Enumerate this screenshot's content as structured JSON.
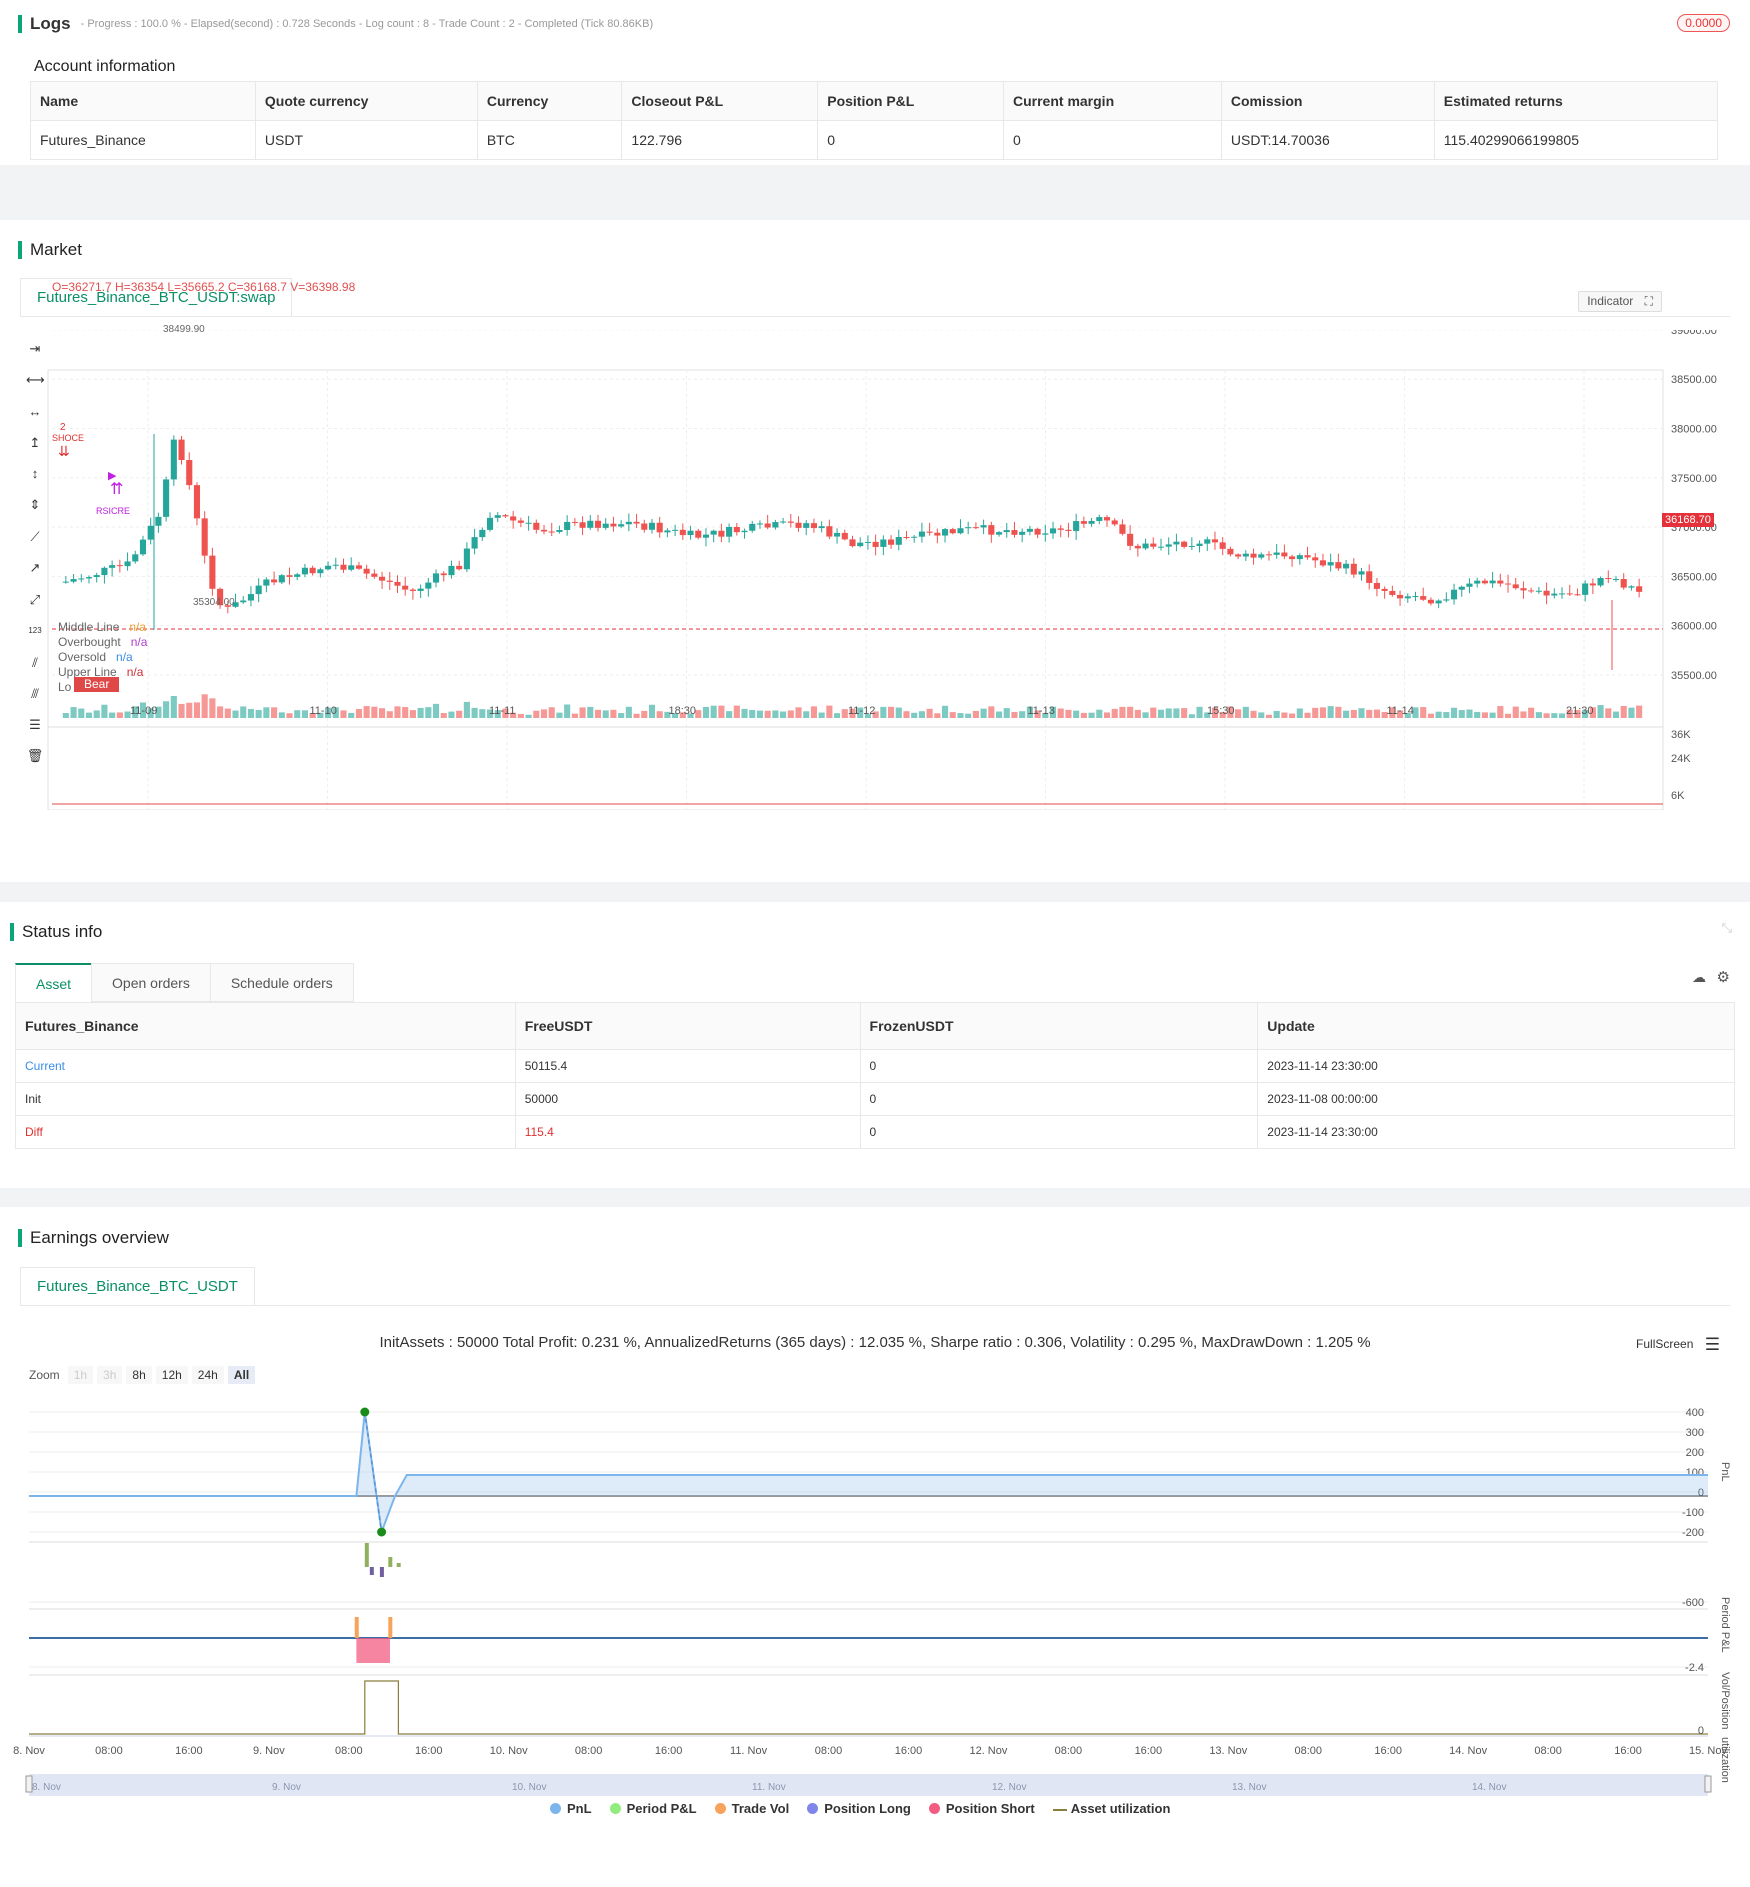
{
  "logs": {
    "title": "Logs",
    "status": "- Progress : 100.0 % - Elapsed(second) : 0.728 Seconds - Log count : 8 - Trade Count : 2 - Completed (Tick 80.86KB)",
    "badge": "0.0000"
  },
  "account": {
    "title": "Account information",
    "headers": [
      "Name",
      "Quote currency",
      "Currency",
      "Closeout P&L",
      "Position P&L",
      "Current margin",
      "Comission",
      "Estimated returns"
    ],
    "row": [
      "Futures_Binance",
      "USDT",
      "BTC",
      "122.796",
      "0",
      "0",
      "USDT:14.70036",
      "115.40299066199805"
    ]
  },
  "market": {
    "title": "Market",
    "tab": "Futures_Binance_BTC_USDT:swap",
    "ohlc": "O=36271.7 H=36354 L=35665.2 C=36168.7 V=36398.98",
    "indicator_btn": "Indicator",
    "price_axis": [
      "39000.00",
      "38500.00",
      "38000.00",
      "37500.00",
      "37000.00",
      "36500.00",
      "36000.00",
      "35500.00"
    ],
    "current_price": "36168.70",
    "high_label": "38499.90",
    "low_label": "35304.00",
    "vol_axis": [
      "36K",
      "24K",
      "6K"
    ],
    "time_axis": [
      "11-09",
      "11-10",
      "11-11",
      "18:30",
      "11-12",
      "11-13",
      "15:30",
      "11-14",
      "21:30"
    ],
    "legend": [
      {
        "name": "Middle Line",
        "value": "n/a",
        "color": "#f0a030"
      },
      {
        "name": "Overbought",
        "value": "n/a",
        "color": "#b040d0"
      },
      {
        "name": "Oversold",
        "value": "n/a",
        "color": "#3a8ee6"
      },
      {
        "name": "Upper Line",
        "value": "n/a",
        "color": "#d0303a"
      },
      {
        "name": "Lo",
        "value": "n/a",
        "color": "#26a69a"
      }
    ],
    "bear_label": "Bear",
    "sig_top": "2",
    "sig_close": "SHOCE",
    "sig_rsi": "RSICRE",
    "colors": {
      "up": "#26a69a",
      "down": "#ef5350"
    }
  },
  "status": {
    "title": "Status info",
    "tabs": [
      "Asset",
      "Open orders",
      "Schedule orders"
    ],
    "headers": [
      "Futures_Binance",
      "FreeUSDT",
      "FrozenUSDT",
      "Update"
    ],
    "rows": [
      [
        "Current",
        "50115.4",
        "0",
        "2023-11-14 23:30:00"
      ],
      [
        "Init",
        "50000",
        "0",
        "2023-11-08 00:00:00"
      ],
      [
        "Diff",
        "115.4",
        "0",
        "2023-11-14 23:30:00"
      ]
    ]
  },
  "earnings": {
    "title": "Earnings overview",
    "tab": "Futures_Binance_BTC_USDT",
    "summary": "InitAssets : 50000 Total Profit: 0.231 %, AnnualizedReturns (365 days) : 12.035 %, Sharpe ratio : 0.306, Volatility : 0.295 %, MaxDrawDown : 1.205 %",
    "fullscreen": "FullScreen",
    "zoom_label": "Zoom",
    "zoom": [
      "1h",
      "3h",
      "8h",
      "12h",
      "24h",
      "All"
    ],
    "pnl_axis": [
      "400",
      "300",
      "200",
      "100",
      "0",
      "-100",
      "-200"
    ],
    "period_axis": "-600",
    "vol_axis": "-2.4",
    "util_axis": "0",
    "axis_names": [
      "PnL",
      "Period P&L",
      "Vol/Position",
      "utilization"
    ],
    "x_axis": [
      "8. Nov",
      "08:00",
      "16:00",
      "9. Nov",
      "08:00",
      "16:00",
      "10. Nov",
      "08:00",
      "16:00",
      "11. Nov",
      "08:00",
      "16:00",
      "12. Nov",
      "08:00",
      "16:00",
      "13. Nov",
      "08:00",
      "16:00",
      "14. Nov",
      "08:00",
      "16:00",
      "15. Nov"
    ],
    "nav_axis": [
      "8. Nov",
      "9. Nov",
      "10. Nov",
      "11. Nov",
      "12. Nov",
      "13. Nov",
      "14. Nov"
    ],
    "legend": [
      {
        "name": "PnL",
        "color": "#7cb5ec"
      },
      {
        "name": "Period P&L",
        "color": "#90ed7d"
      },
      {
        "name": "Trade Vol",
        "color": "#f7a35c"
      },
      {
        "name": "Position Long",
        "color": "#8085e9"
      },
      {
        "name": "Position Short",
        "color": "#f15c80"
      },
      {
        "name": "Asset utilization",
        "color": "#8b7d3a"
      }
    ]
  }
}
